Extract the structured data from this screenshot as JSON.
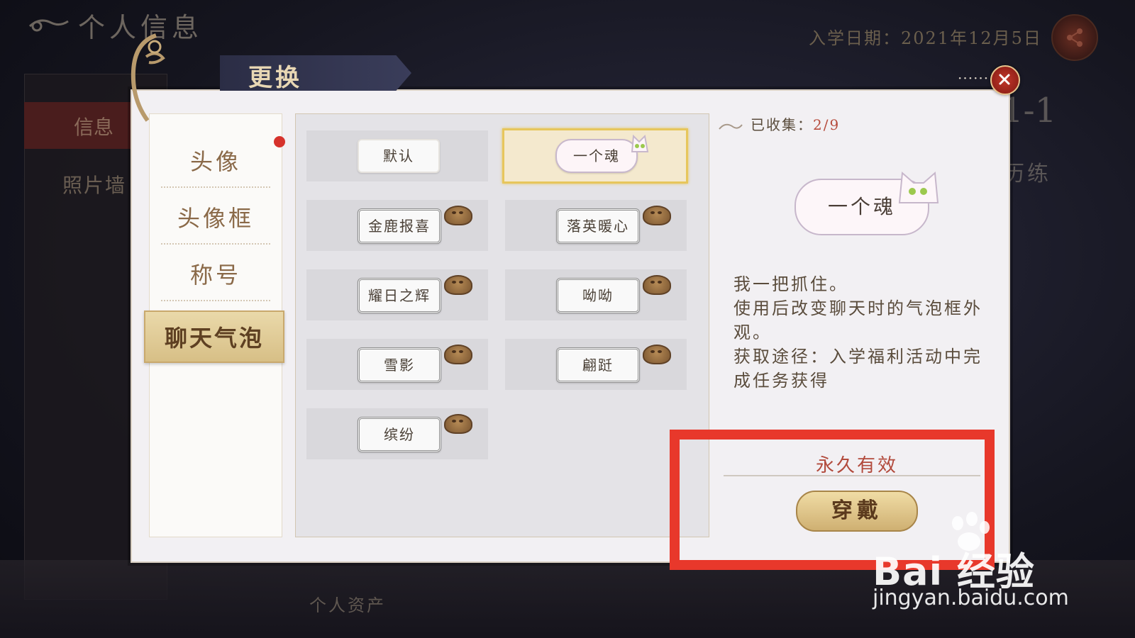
{
  "background": {
    "page_title": "个人信息",
    "enroll_date": "入学日期：2021年12月5日",
    "tab_info": "信息",
    "photo_wall": "照片墙",
    "level_partial": "1-1",
    "training_partial": "历练",
    "assets": "个人资产"
  },
  "dialog": {
    "title": "更换",
    "categories": [
      "头像",
      "头像框",
      "称号"
    ],
    "active_category": "聊天气泡",
    "items": [
      {
        "label": "默认"
      },
      {
        "label": "一个魂"
      },
      {
        "label": "金鹿报喜"
      },
      {
        "label": "落英暖心"
      },
      {
        "label": "耀日之辉"
      },
      {
        "label": "呦呦"
      },
      {
        "label": "雪影"
      },
      {
        "label": "翩跹"
      },
      {
        "label": "缤纷"
      }
    ],
    "collected_label": "已收集：",
    "collected_value": "2/9",
    "preview_label": "一个魂",
    "description": [
      "我一把抓住。",
      "使用后改变聊天时的气泡框外观。",
      "获取途径：入学福利活动中完成任务获得"
    ],
    "validity": "永久有效",
    "wear_button": "穿戴"
  },
  "watermark": {
    "brand": "Bai 经验",
    "url": "jingyan.baidu.com"
  },
  "colors": {
    "accent_gold": "#e7c65c",
    "highlight_red": "#e8382b",
    "close_red": "#c2372a"
  }
}
